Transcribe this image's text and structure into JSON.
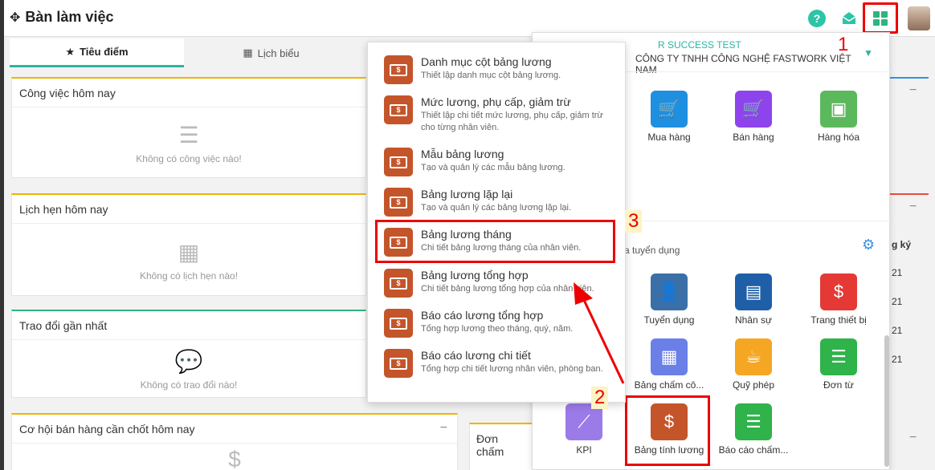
{
  "header": {
    "title": "Bàn làm việc"
  },
  "tabs": [
    {
      "label": "Tiêu điểm",
      "icon": "star-icon"
    },
    {
      "label": "Lịch biểu",
      "icon": "calendar-icon"
    }
  ],
  "cards": [
    {
      "title": "Công việc hôm nay",
      "empty": "Không có công việc nào!",
      "icon": "server-icon"
    },
    {
      "title": "Lịch hẹn hôm nay",
      "empty": "Không có lịch hẹn nào!",
      "icon": "calendar-icon"
    },
    {
      "title": "Trao đổi gần nhất",
      "empty": "Không có trao đổi nào!",
      "icon": "comments-icon"
    },
    {
      "title": "Cơ hội bán hàng cần chốt hôm nay",
      "icon": "dollar-icon"
    }
  ],
  "panel": {
    "org_line1": "R SUCCESS TEST",
    "org_line2": "CÔNG TY TNHH CÔNG NGHỆ FASTWORK VIỆT NAM",
    "section_label": "a tuyển dụng",
    "apps": [
      {
        "label": "Mua hàng",
        "color": "#1f8fe0",
        "icon": "cart-download-icon"
      },
      {
        "label": "Bán hàng",
        "color": "#8e44ec",
        "icon": "cart-add-icon"
      },
      {
        "label": "Hàng hóa",
        "color": "#5cb85c",
        "icon": "box-icon"
      },
      {
        "label": "Tuyển dụng",
        "color": "#3a6fa8",
        "icon": "user-add-icon"
      },
      {
        "label": "Nhân sự",
        "color": "#1f5fa8",
        "icon": "id-card-icon"
      },
      {
        "label": "Trang thiết bị",
        "color": "#e53935",
        "icon": "money-bag-icon"
      },
      {
        "label": "Bảng chấm cô...",
        "color": "#6a7fe8",
        "icon": "calendar-grid-icon"
      },
      {
        "label": "Quỹ phép",
        "color": "#f5a623",
        "icon": "coffee-icon"
      },
      {
        "label": "Đơn từ",
        "color": "#2fb34a",
        "icon": "document-icon"
      },
      {
        "label": "KPI",
        "color": "#9b7be8",
        "icon": "chart-line-icon"
      },
      {
        "label": "Bảng tính lương",
        "color": "#c4552b",
        "icon": "money-icon"
      },
      {
        "label": "Báo cáo chấm...",
        "color": "#2fb34a",
        "icon": "report-icon"
      }
    ]
  },
  "menu": [
    {
      "title": "Danh mục cột bảng lương",
      "desc": "Thiết lập danh mục cột bảng lương."
    },
    {
      "title": "Mức lương, phụ cấp, giảm trừ",
      "desc": "Thiết lập chi tiết mức lương, phụ cấp, giảm trừ cho từng nhân viên."
    },
    {
      "title": "Mẫu bảng lương",
      "desc": "Tạo và quản lý các mẫu bảng lương."
    },
    {
      "title": "Bảng lương lặp lại",
      "desc": "Tạo và quản lý các bảng lương lặp lại."
    },
    {
      "title": "Bảng lương tháng",
      "desc": "Chi tiết bảng lương tháng của nhân viên."
    },
    {
      "title": "Bảng lương tổng hợp",
      "desc": "Chi tiết bảng lương tổng hợp của nhân viên."
    },
    {
      "title": "Báo cáo lương tổng hợp",
      "desc": "Tổng hợp lương theo tháng, quý, năm."
    },
    {
      "title": "Báo cáo lương chi tiết",
      "desc": "Tổng hợp chi tiết lương nhân viên, phòng ban."
    }
  ],
  "right": {
    "col_header": "g ký",
    "values": [
      "21",
      "21",
      "21",
      "21"
    ],
    "donchám": "Đơn chấm"
  },
  "annotations": {
    "step1": "1",
    "step2": "2",
    "step3": "3",
    "icon_bill": "$"
  }
}
